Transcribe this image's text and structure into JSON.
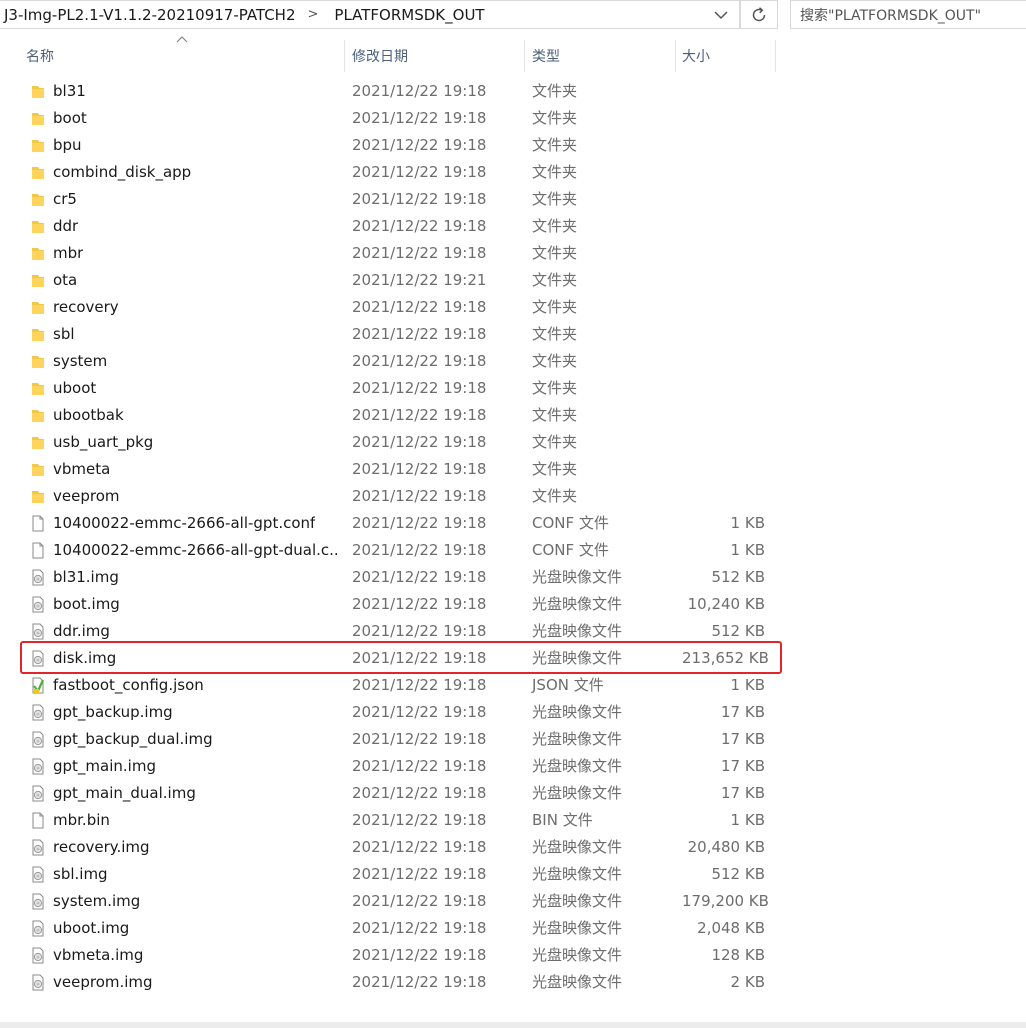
{
  "address_bar": {
    "crumbs": [
      "J3-Img-PL2.1-V1.1.2-20210917-PATCH2",
      "PLATFORMSDK_OUT"
    ],
    "separator": ">"
  },
  "search": {
    "placeholder": "搜索\"PLATFORMSDK_OUT\""
  },
  "columns": {
    "name": "名称",
    "date": "修改日期",
    "type": "类型",
    "size": "大小"
  },
  "highlight_color": "#e0262c",
  "folder_color": "#f2c84b",
  "files": [
    {
      "name": "bl31",
      "date": "2021/12/22 19:18",
      "type": "文件夹",
      "size": "",
      "icon": "folder-icon"
    },
    {
      "name": "boot",
      "date": "2021/12/22 19:18",
      "type": "文件夹",
      "size": "",
      "icon": "folder-icon"
    },
    {
      "name": "bpu",
      "date": "2021/12/22 19:18",
      "type": "文件夹",
      "size": "",
      "icon": "folder-icon"
    },
    {
      "name": "combind_disk_app",
      "date": "2021/12/22 19:18",
      "type": "文件夹",
      "size": "",
      "icon": "folder-icon"
    },
    {
      "name": "cr5",
      "date": "2021/12/22 19:18",
      "type": "文件夹",
      "size": "",
      "icon": "folder-icon"
    },
    {
      "name": "ddr",
      "date": "2021/12/22 19:18",
      "type": "文件夹",
      "size": "",
      "icon": "folder-icon"
    },
    {
      "name": "mbr",
      "date": "2021/12/22 19:18",
      "type": "文件夹",
      "size": "",
      "icon": "folder-icon"
    },
    {
      "name": "ota",
      "date": "2021/12/22 19:21",
      "type": "文件夹",
      "size": "",
      "icon": "folder-icon"
    },
    {
      "name": "recovery",
      "date": "2021/12/22 19:18",
      "type": "文件夹",
      "size": "",
      "icon": "folder-icon"
    },
    {
      "name": "sbl",
      "date": "2021/12/22 19:18",
      "type": "文件夹",
      "size": "",
      "icon": "folder-icon"
    },
    {
      "name": "system",
      "date": "2021/12/22 19:18",
      "type": "文件夹",
      "size": "",
      "icon": "folder-icon"
    },
    {
      "name": "uboot",
      "date": "2021/12/22 19:18",
      "type": "文件夹",
      "size": "",
      "icon": "folder-icon"
    },
    {
      "name": "ubootbak",
      "date": "2021/12/22 19:18",
      "type": "文件夹",
      "size": "",
      "icon": "folder-icon"
    },
    {
      "name": "usb_uart_pkg",
      "date": "2021/12/22 19:18",
      "type": "文件夹",
      "size": "",
      "icon": "folder-icon"
    },
    {
      "name": "vbmeta",
      "date": "2021/12/22 19:18",
      "type": "文件夹",
      "size": "",
      "icon": "folder-icon"
    },
    {
      "name": "veeprom",
      "date": "2021/12/22 19:18",
      "type": "文件夹",
      "size": "",
      "icon": "folder-icon"
    },
    {
      "name": "10400022-emmc-2666-all-gpt.conf",
      "date": "2021/12/22 19:18",
      "type": "CONF 文件",
      "size": "1 KB",
      "icon": "file-icon"
    },
    {
      "name": "10400022-emmc-2666-all-gpt-dual.c...",
      "date": "2021/12/22 19:18",
      "type": "CONF 文件",
      "size": "1 KB",
      "icon": "file-icon"
    },
    {
      "name": "bl31.img",
      "date": "2021/12/22 19:18",
      "type": "光盘映像文件",
      "size": "512 KB",
      "icon": "disc-image-icon"
    },
    {
      "name": "boot.img",
      "date": "2021/12/22 19:18",
      "type": "光盘映像文件",
      "size": "10,240 KB",
      "icon": "disc-image-icon"
    },
    {
      "name": "ddr.img",
      "date": "2021/12/22 19:18",
      "type": "光盘映像文件",
      "size": "512 KB",
      "icon": "disc-image-icon"
    },
    {
      "name": "disk.img",
      "date": "2021/12/22 19:18",
      "type": "光盘映像文件",
      "size": "213,652 KB",
      "icon": "disc-image-icon",
      "highlighted": true
    },
    {
      "name": "fastboot_config.json",
      "date": "2021/12/22 19:18",
      "type": "JSON 文件",
      "size": "1 KB",
      "icon": "json-file-icon"
    },
    {
      "name": "gpt_backup.img",
      "date": "2021/12/22 19:18",
      "type": "光盘映像文件",
      "size": "17 KB",
      "icon": "disc-image-icon"
    },
    {
      "name": "gpt_backup_dual.img",
      "date": "2021/12/22 19:18",
      "type": "光盘映像文件",
      "size": "17 KB",
      "icon": "disc-image-icon"
    },
    {
      "name": "gpt_main.img",
      "date": "2021/12/22 19:18",
      "type": "光盘映像文件",
      "size": "17 KB",
      "icon": "disc-image-icon"
    },
    {
      "name": "gpt_main_dual.img",
      "date": "2021/12/22 19:18",
      "type": "光盘映像文件",
      "size": "17 KB",
      "icon": "disc-image-icon"
    },
    {
      "name": "mbr.bin",
      "date": "2021/12/22 19:18",
      "type": "BIN 文件",
      "size": "1 KB",
      "icon": "file-icon"
    },
    {
      "name": "recovery.img",
      "date": "2021/12/22 19:18",
      "type": "光盘映像文件",
      "size": "20,480 KB",
      "icon": "disc-image-icon"
    },
    {
      "name": "sbl.img",
      "date": "2021/12/22 19:18",
      "type": "光盘映像文件",
      "size": "512 KB",
      "icon": "disc-image-icon"
    },
    {
      "name": "system.img",
      "date": "2021/12/22 19:18",
      "type": "光盘映像文件",
      "size": "179,200 KB",
      "icon": "disc-image-icon"
    },
    {
      "name": "uboot.img",
      "date": "2021/12/22 19:18",
      "type": "光盘映像文件",
      "size": "2,048 KB",
      "icon": "disc-image-icon"
    },
    {
      "name": "vbmeta.img",
      "date": "2021/12/22 19:18",
      "type": "光盘映像文件",
      "size": "128 KB",
      "icon": "disc-image-icon"
    },
    {
      "name": "veeprom.img",
      "date": "2021/12/22 19:18",
      "type": "光盘映像文件",
      "size": "2 KB",
      "icon": "disc-image-icon"
    }
  ]
}
